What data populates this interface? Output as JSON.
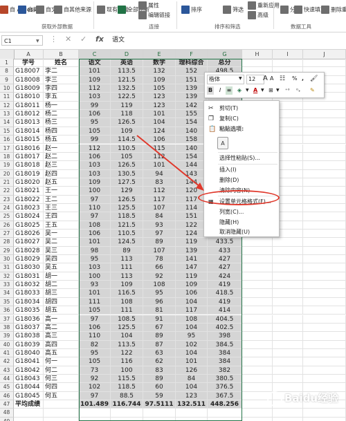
{
  "ribbon": {
    "items": [
      {
        "label": "自 Access",
        "color": "#b7472a"
      },
      {
        "label": "自网站",
        "color": "#2b579a"
      },
      {
        "label": "自文本",
        "color": "#6e6e6e"
      },
      {
        "label": "自其他来源",
        "color": "#6e6e6e"
      },
      {
        "label": "现有连接",
        "color": "#6e6e6e"
      },
      {
        "label": "全部刷新",
        "color": "#217346"
      },
      {
        "label": "属性",
        "color": "#6e6e6e"
      },
      {
        "label": "编辑链接",
        "color": "#6e6e6e"
      },
      {
        "label": "排序",
        "color": "#2b579a"
      },
      {
        "label": "筛选",
        "color": "#6e6e6e"
      },
      {
        "label": "重新应用",
        "color": "#6e6e6e"
      },
      {
        "label": "高级",
        "color": "#6e6e6e"
      },
      {
        "label": "分列",
        "color": "#6e6e6e"
      },
      {
        "label": "快速填充",
        "color": "#6e6e6e"
      },
      {
        "label": "删除重复项",
        "color": "#6e6e6e"
      }
    ],
    "groups": [
      "获取外部数据",
      "连接",
      "排序和筛选",
      "数据工具"
    ]
  },
  "formula_bar": {
    "name_box": "C1",
    "formula": "语文"
  },
  "columns": [
    "A",
    "B",
    "C",
    "D",
    "E",
    "F",
    "G",
    "H",
    "I",
    "J"
  ],
  "headers": [
    "学号",
    "姓名",
    "语文",
    "英语",
    "数学",
    "理科综合",
    "总分"
  ],
  "rows": [
    [
      "G18007",
      "李二",
      "101",
      "113.5",
      "132",
      "152",
      "498.5"
    ],
    [
      "G18008",
      "李三",
      "109",
      "121.5",
      "109",
      "151",
      "490.5"
    ],
    [
      "G18009",
      "李四",
      "112",
      "132.5",
      "105",
      "139",
      "488.5"
    ],
    [
      "G18010",
      "李五",
      "103",
      "122.5",
      "123",
      "139",
      "487.5"
    ],
    [
      "G18011",
      "杨一",
      "99",
      "119",
      "123",
      "142",
      "483"
    ],
    [
      "G18012",
      "杨二",
      "106",
      "118",
      "101",
      "155",
      "480"
    ],
    [
      "G18013",
      "杨三",
      "95",
      "126.5",
      "104",
      "154",
      "479.5"
    ],
    [
      "G18014",
      "杨四",
      "105",
      "109",
      "124",
      "140",
      "478"
    ],
    [
      "G18015",
      "杨五",
      "99",
      "114.5",
      "106",
      "158",
      "477.5"
    ],
    [
      "G18016",
      "赵一",
      "112",
      "110.5",
      "115",
      "140",
      "477.5"
    ],
    [
      "G18017",
      "赵二",
      "106",
      "105",
      "112",
      "154",
      "477"
    ],
    [
      "G18018",
      "赵三",
      "103",
      "126.5",
      "101",
      "144",
      "474.5"
    ],
    [
      "G18019",
      "赵四",
      "103",
      "130.5",
      "94",
      "143",
      "470.5"
    ],
    [
      "G18020",
      "赵五",
      "109",
      "127.5",
      "83",
      "144",
      "463.5"
    ],
    [
      "G18021",
      "王一",
      "100",
      "129",
      "112",
      "120",
      "461"
    ],
    [
      "G18022",
      "王二",
      "97",
      "126.5",
      "117",
      "117",
      "457.5"
    ],
    [
      "G18023",
      "王三",
      "110",
      "125.5",
      "107",
      "114",
      "456.5"
    ],
    [
      "G18024",
      "王四",
      "97",
      "118.5",
      "84",
      "151",
      "450.5"
    ],
    [
      "G18025",
      "王五",
      "108",
      "121.5",
      "93",
      "122",
      "444.5"
    ],
    [
      "G18026",
      "吴一",
      "106",
      "110.5",
      "97",
      "124",
      "437.5"
    ],
    [
      "G18027",
      "吴二",
      "101",
      "124.5",
      "89",
      "119",
      "433.5"
    ],
    [
      "G18028",
      "吴三",
      "98",
      "89",
      "107",
      "139",
      "433"
    ],
    [
      "G18029",
      "吴四",
      "95",
      "113",
      "78",
      "141",
      "427"
    ],
    [
      "G18030",
      "吴五",
      "103",
      "111",
      "66",
      "147",
      "427"
    ],
    [
      "G18031",
      "胡一",
      "100",
      "113",
      "92",
      "119",
      "424"
    ],
    [
      "G18032",
      "胡二",
      "93",
      "109",
      "108",
      "109",
      "419"
    ],
    [
      "G18033",
      "胡三",
      "101",
      "116.5",
      "95",
      "106",
      "418.5"
    ],
    [
      "G18034",
      "胡四",
      "111",
      "108",
      "96",
      "104",
      "419"
    ],
    [
      "G18035",
      "胡五",
      "105",
      "111",
      "81",
      "117",
      "414"
    ],
    [
      "G18036",
      "高一",
      "97",
      "108.5",
      "91",
      "108",
      "404.5"
    ],
    [
      "G18037",
      "高二",
      "106",
      "125.5",
      "67",
      "104",
      "402.5"
    ],
    [
      "G18038",
      "高三",
      "110",
      "104",
      "89",
      "95",
      "398"
    ],
    [
      "G18039",
      "高四",
      "82",
      "113.5",
      "87",
      "102",
      "384.5"
    ],
    [
      "G18040",
      "高五",
      "95",
      "122",
      "63",
      "104",
      "384"
    ],
    [
      "G18041",
      "何一",
      "105",
      "116",
      "62",
      "101",
      "384"
    ],
    [
      "G18042",
      "何二",
      "73",
      "100",
      "83",
      "126",
      "382"
    ],
    [
      "G18043",
      "何三",
      "92",
      "115.5",
      "89",
      "84",
      "380.5"
    ],
    [
      "G18044",
      "何四",
      "102",
      "118.5",
      "60",
      "104",
      "376.5"
    ],
    [
      "G18045",
      "何五",
      "97",
      "88.5",
      "59",
      "123",
      "367.5"
    ]
  ],
  "footer": [
    "平均成绩",
    "",
    "101.489",
    "116.744",
    "97.5111",
    "132.511",
    "448.256"
  ],
  "row_numbers": [
    "1",
    "8",
    "9",
    "10",
    "11",
    "12",
    "13",
    "14",
    "15",
    "16",
    "17",
    "18",
    "19",
    "20",
    "21",
    "22",
    "23",
    "24",
    "25",
    "26",
    "27",
    "28",
    "29",
    "30",
    "31",
    "32",
    "33",
    "34",
    "35",
    "36",
    "37",
    "38",
    "39",
    "40",
    "41",
    "42",
    "43",
    "44",
    "45",
    "46",
    "47",
    "48",
    "49"
  ],
  "mini_toolbar": {
    "font": "楷体",
    "size": "12",
    "percent": "%",
    "comma": ","
  },
  "context_menu": {
    "items": [
      "剪切(T)",
      "复制(C)",
      "粘贴选项:",
      "选择性粘贴(S)...",
      "插入(I)",
      "删除(D)",
      "清除内容(N)",
      "设置单元格格式(F)...",
      "列宽(C)...",
      "隐藏(H)",
      "取消隐藏(U)"
    ],
    "highlighted": "设置单元格格式(F)..."
  },
  "annotation_color": "#e0382b",
  "selection_color": "#217346",
  "watermark": "Baidu经验"
}
